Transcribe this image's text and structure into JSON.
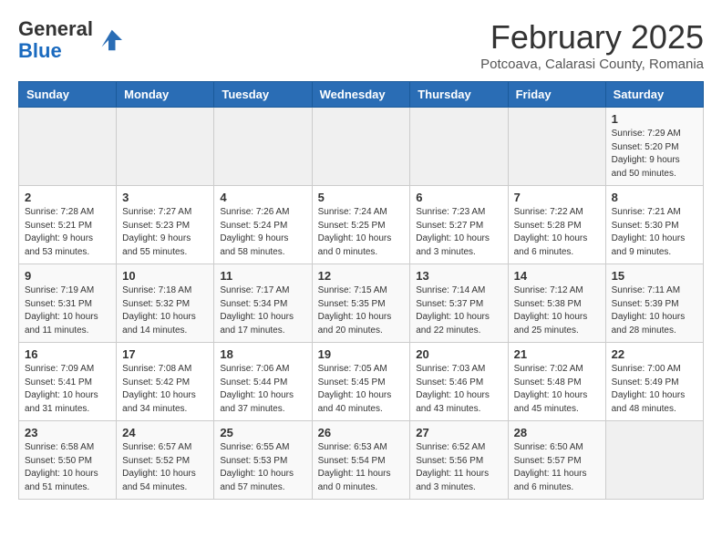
{
  "header": {
    "logo_line1": "General",
    "logo_line2": "Blue",
    "month": "February 2025",
    "location": "Potcoava, Calarasi County, Romania"
  },
  "weekdays": [
    "Sunday",
    "Monday",
    "Tuesday",
    "Wednesday",
    "Thursday",
    "Friday",
    "Saturday"
  ],
  "weeks": [
    [
      {
        "day": "",
        "info": ""
      },
      {
        "day": "",
        "info": ""
      },
      {
        "day": "",
        "info": ""
      },
      {
        "day": "",
        "info": ""
      },
      {
        "day": "",
        "info": ""
      },
      {
        "day": "",
        "info": ""
      },
      {
        "day": "1",
        "info": "Sunrise: 7:29 AM\nSunset: 5:20 PM\nDaylight: 9 hours\nand 50 minutes."
      }
    ],
    [
      {
        "day": "2",
        "info": "Sunrise: 7:28 AM\nSunset: 5:21 PM\nDaylight: 9 hours\nand 53 minutes."
      },
      {
        "day": "3",
        "info": "Sunrise: 7:27 AM\nSunset: 5:23 PM\nDaylight: 9 hours\nand 55 minutes."
      },
      {
        "day": "4",
        "info": "Sunrise: 7:26 AM\nSunset: 5:24 PM\nDaylight: 9 hours\nand 58 minutes."
      },
      {
        "day": "5",
        "info": "Sunrise: 7:24 AM\nSunset: 5:25 PM\nDaylight: 10 hours\nand 0 minutes."
      },
      {
        "day": "6",
        "info": "Sunrise: 7:23 AM\nSunset: 5:27 PM\nDaylight: 10 hours\nand 3 minutes."
      },
      {
        "day": "7",
        "info": "Sunrise: 7:22 AM\nSunset: 5:28 PM\nDaylight: 10 hours\nand 6 minutes."
      },
      {
        "day": "8",
        "info": "Sunrise: 7:21 AM\nSunset: 5:30 PM\nDaylight: 10 hours\nand 9 minutes."
      }
    ],
    [
      {
        "day": "9",
        "info": "Sunrise: 7:19 AM\nSunset: 5:31 PM\nDaylight: 10 hours\nand 11 minutes."
      },
      {
        "day": "10",
        "info": "Sunrise: 7:18 AM\nSunset: 5:32 PM\nDaylight: 10 hours\nand 14 minutes."
      },
      {
        "day": "11",
        "info": "Sunrise: 7:17 AM\nSunset: 5:34 PM\nDaylight: 10 hours\nand 17 minutes."
      },
      {
        "day": "12",
        "info": "Sunrise: 7:15 AM\nSunset: 5:35 PM\nDaylight: 10 hours\nand 20 minutes."
      },
      {
        "day": "13",
        "info": "Sunrise: 7:14 AM\nSunset: 5:37 PM\nDaylight: 10 hours\nand 22 minutes."
      },
      {
        "day": "14",
        "info": "Sunrise: 7:12 AM\nSunset: 5:38 PM\nDaylight: 10 hours\nand 25 minutes."
      },
      {
        "day": "15",
        "info": "Sunrise: 7:11 AM\nSunset: 5:39 PM\nDaylight: 10 hours\nand 28 minutes."
      }
    ],
    [
      {
        "day": "16",
        "info": "Sunrise: 7:09 AM\nSunset: 5:41 PM\nDaylight: 10 hours\nand 31 minutes."
      },
      {
        "day": "17",
        "info": "Sunrise: 7:08 AM\nSunset: 5:42 PM\nDaylight: 10 hours\nand 34 minutes."
      },
      {
        "day": "18",
        "info": "Sunrise: 7:06 AM\nSunset: 5:44 PM\nDaylight: 10 hours\nand 37 minutes."
      },
      {
        "day": "19",
        "info": "Sunrise: 7:05 AM\nSunset: 5:45 PM\nDaylight: 10 hours\nand 40 minutes."
      },
      {
        "day": "20",
        "info": "Sunrise: 7:03 AM\nSunset: 5:46 PM\nDaylight: 10 hours\nand 43 minutes."
      },
      {
        "day": "21",
        "info": "Sunrise: 7:02 AM\nSunset: 5:48 PM\nDaylight: 10 hours\nand 45 minutes."
      },
      {
        "day": "22",
        "info": "Sunrise: 7:00 AM\nSunset: 5:49 PM\nDaylight: 10 hours\nand 48 minutes."
      }
    ],
    [
      {
        "day": "23",
        "info": "Sunrise: 6:58 AM\nSunset: 5:50 PM\nDaylight: 10 hours\nand 51 minutes."
      },
      {
        "day": "24",
        "info": "Sunrise: 6:57 AM\nSunset: 5:52 PM\nDaylight: 10 hours\nand 54 minutes."
      },
      {
        "day": "25",
        "info": "Sunrise: 6:55 AM\nSunset: 5:53 PM\nDaylight: 10 hours\nand 57 minutes."
      },
      {
        "day": "26",
        "info": "Sunrise: 6:53 AM\nSunset: 5:54 PM\nDaylight: 11 hours\nand 0 minutes."
      },
      {
        "day": "27",
        "info": "Sunrise: 6:52 AM\nSunset: 5:56 PM\nDaylight: 11 hours\nand 3 minutes."
      },
      {
        "day": "28",
        "info": "Sunrise: 6:50 AM\nSunset: 5:57 PM\nDaylight: 11 hours\nand 6 minutes."
      },
      {
        "day": "",
        "info": ""
      }
    ]
  ]
}
